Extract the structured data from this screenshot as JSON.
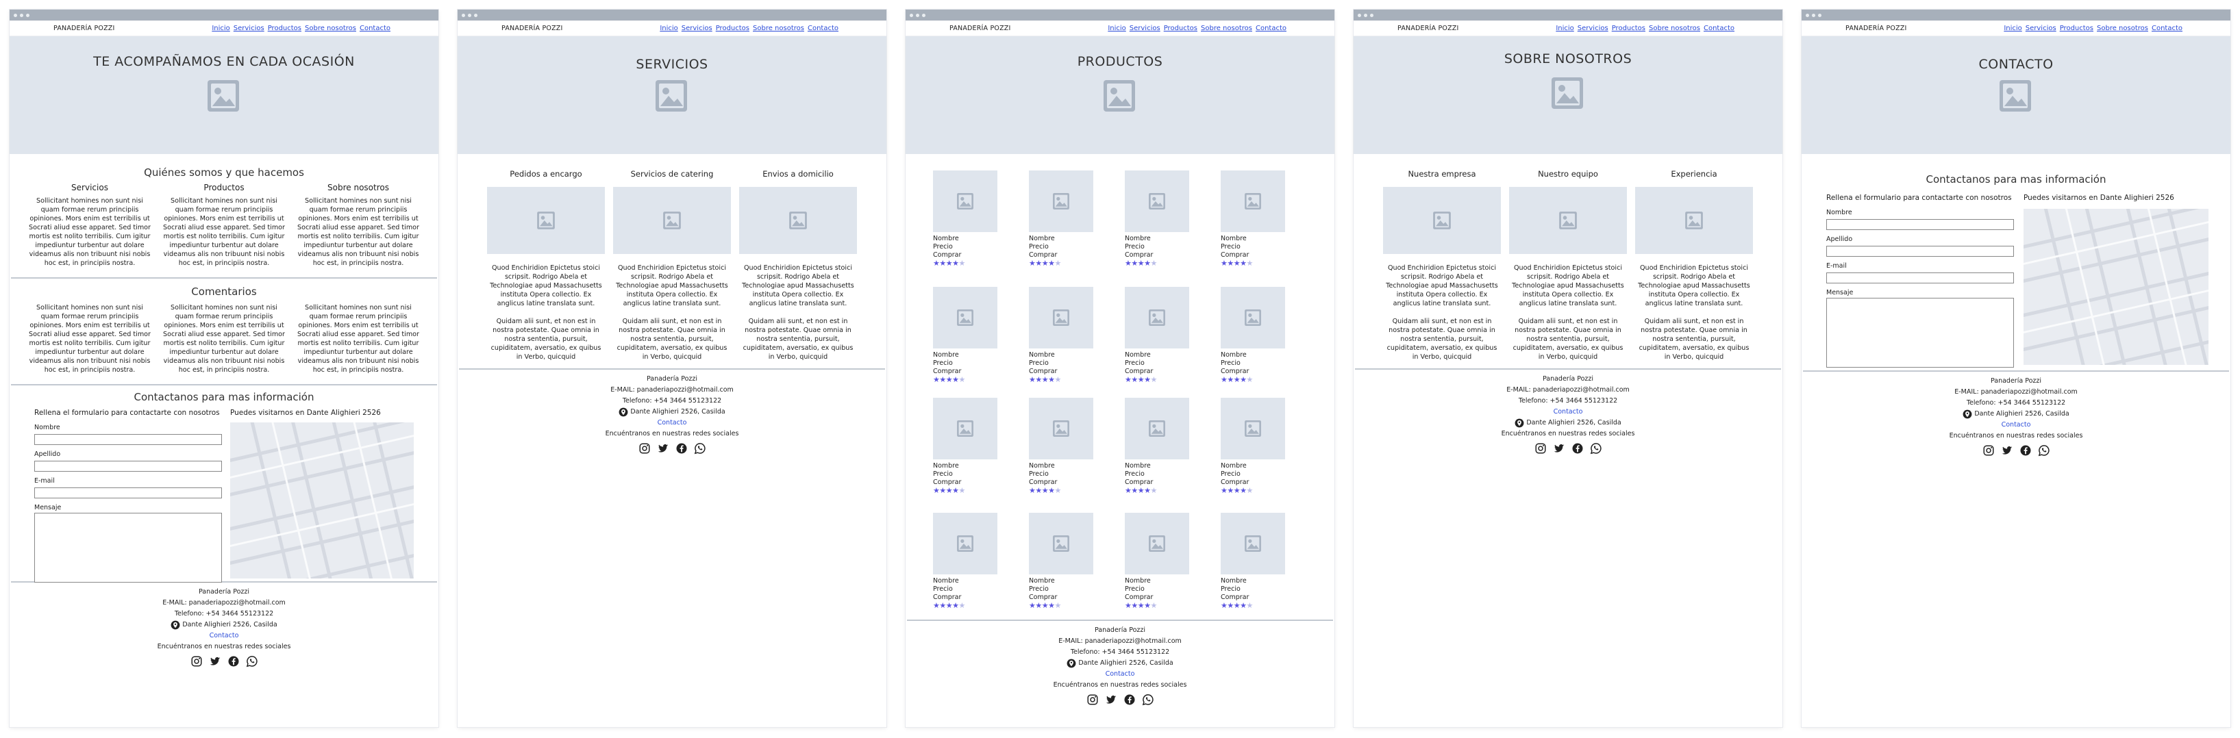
{
  "nav": {
    "brand": "PANADERÍA POZZI",
    "links": [
      "Inicio",
      "Servicios",
      "Productos",
      "Sobre nosotros",
      "Contacto"
    ]
  },
  "lorem_short": "Sollicitant homines non sunt nisi quam formae rerum principiis opiniones. Mors enim est terribilis ut Socrati aliud esse apparet. Sed timor mortis est nolito terribilis. Cum igitur impediuntur turbentur aut dolare videamus alis non tribuunt nisi nobis hoc est, in principiis nostra.",
  "lorem_a": "Quod Enchiridion Epictetus stoici scripsit. Rodrigo Abela et Technologiae apud Massachusetts instituta Opera collectio. Ex anglicus latine translata sunt.",
  "lorem_b": "Quidam alii sunt, et non est in nostra potestate. Quae omnia in nostra sententia, pursuit, cupiditatem, aversatio, ex quibus in Verbo, quicquid",
  "home": {
    "hero_title": "TE ACOMPAÑAMOS EN CADA OCASIÓN",
    "about_title": "Quiénes somos y que hacemos",
    "about_cols": [
      "Servicios",
      "Productos",
      "Sobre nosotros"
    ],
    "comments_title": "Comentarios"
  },
  "contact": {
    "title": "Contactanos para mas información",
    "form_heading": "Rellena el formulario para contactarte con nosotros",
    "map_heading": "Puedes visitarnos en Dante Alighieri 2526",
    "labels": [
      "Nombre",
      "Apellido",
      "E-mail",
      "Mensaje"
    ]
  },
  "services": {
    "hero_title": "SERVICIOS",
    "cols": [
      "Pedidos a encargo",
      "Servicios de catering",
      "Envios a domicilio"
    ]
  },
  "products": {
    "hero_title": "PRODUCTOS",
    "item_labels": [
      "Nombre",
      "Precio",
      "Comprar"
    ],
    "rating": 4,
    "max_rating": 5
  },
  "about": {
    "hero_title": "SOBRE NOSOTROS",
    "cols": [
      "Nuestra empresa",
      "Nuestro equipo",
      "Experiencia"
    ]
  },
  "contact_page": {
    "hero_title": "CONTACTO"
  },
  "footer": {
    "name": "Panadería Pozzi",
    "email": "E-MAIL: panaderiapozzi@hotmail.com",
    "phone": "Telefono: +54 3464 55123122",
    "address": "Dante Alighieri 2526, Casilda",
    "contact": "Contacto",
    "social_text": "Encuéntranos en nuestras redes sociales"
  },
  "icons": {
    "image": "image-placeholder-icon",
    "location": "location-pin-icon",
    "social": [
      "instagram-icon",
      "twitter-icon",
      "facebook-icon",
      "whatsapp-icon"
    ]
  },
  "colors": {
    "hero_bg": "#dfe5ed",
    "link": "#2a4bd8",
    "stars": "#5b55e0",
    "window_bar": "#a7b0bb"
  }
}
